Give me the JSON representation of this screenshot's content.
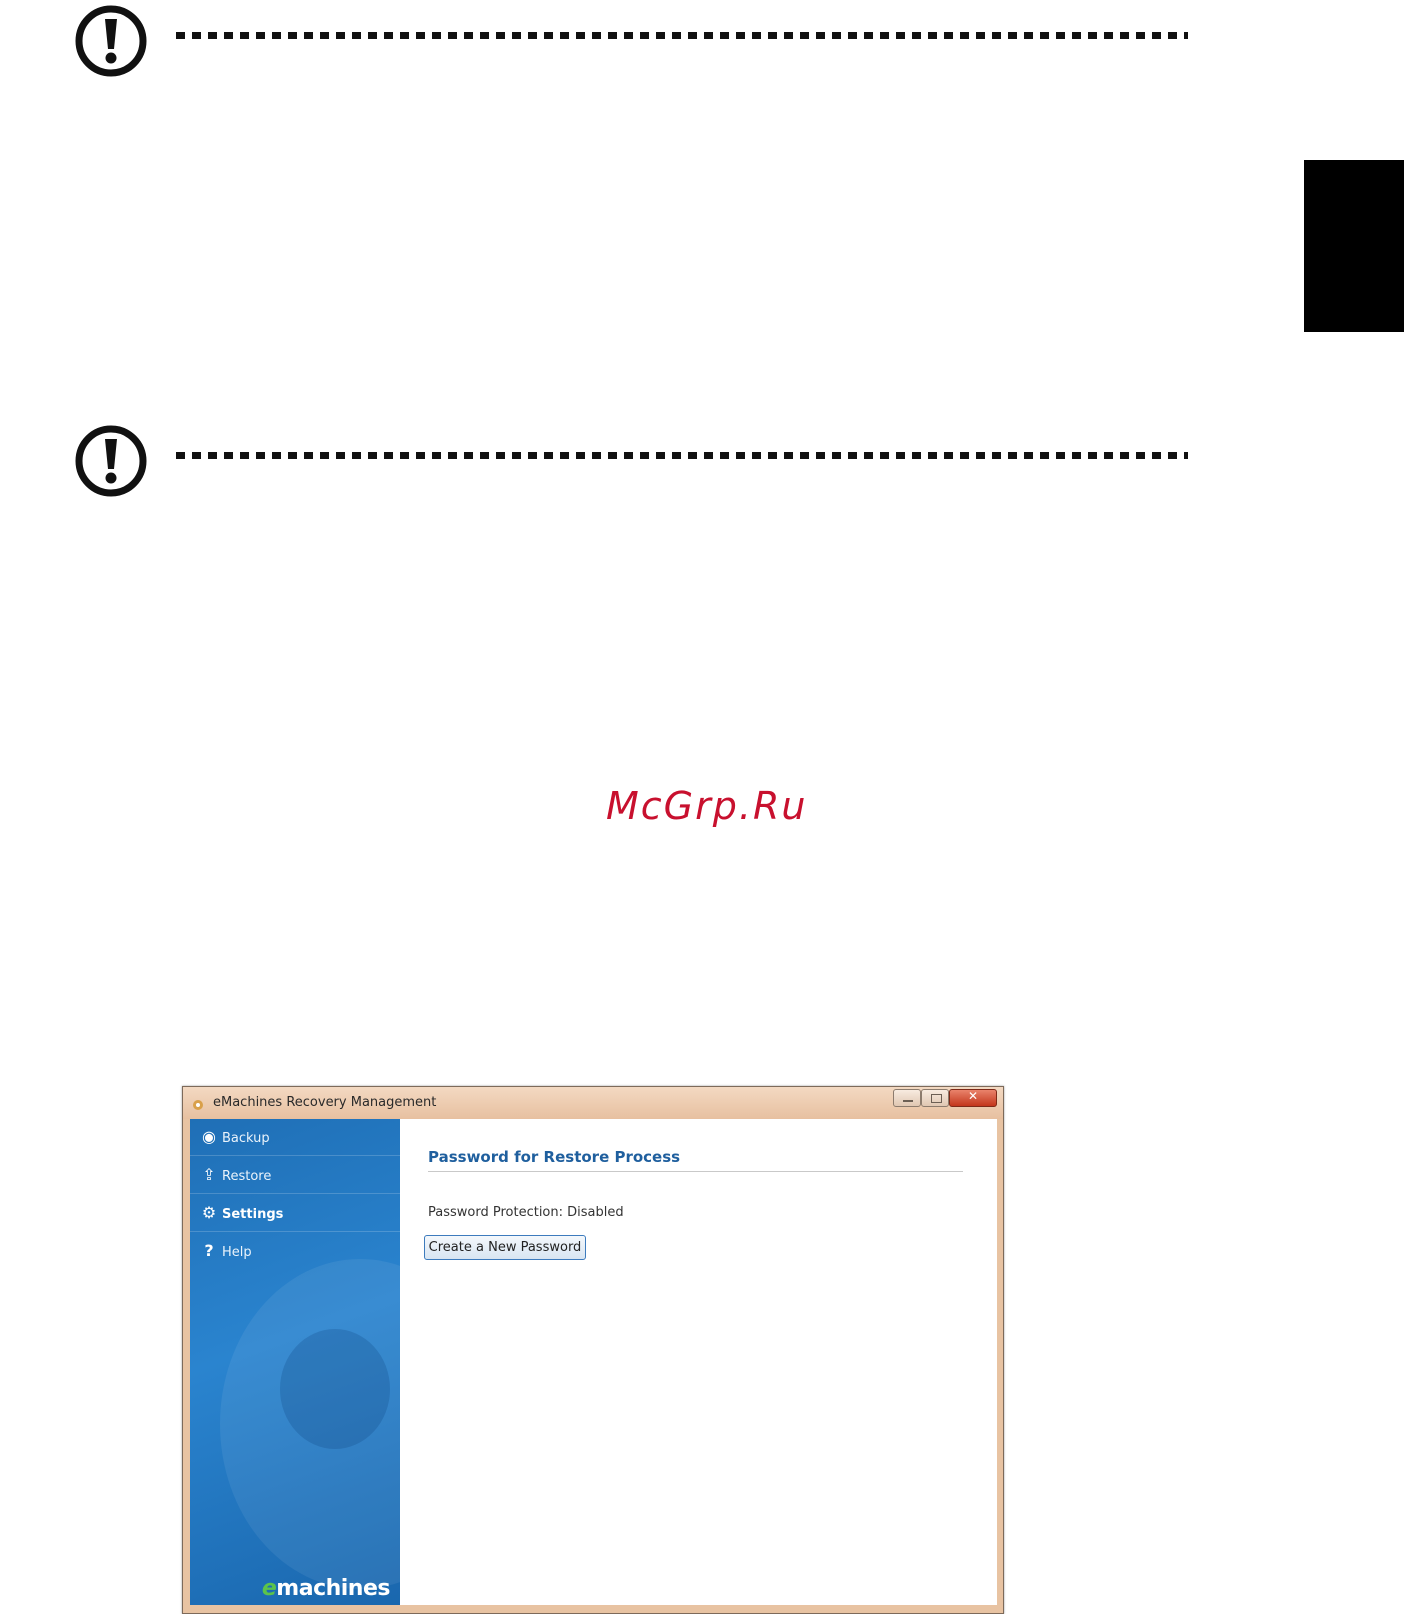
{
  "page": {
    "side_tab_color": "#000000",
    "watermark": "McGrp.Ru",
    "watermark_color": "#c8102e"
  },
  "icons": {
    "warning_1": "exclamation-circle-icon",
    "warning_2": "exclamation-circle-icon"
  },
  "window": {
    "title": "eMachines Recovery Management",
    "sidebar": {
      "items": [
        {
          "label": "Backup",
          "icon": "backup-icon"
        },
        {
          "label": "Restore",
          "icon": "restore-icon"
        },
        {
          "label": "Settings",
          "icon": "gear-icon",
          "active": true
        },
        {
          "label": "Help",
          "icon": "help-icon"
        }
      ],
      "brand_prefix": "e",
      "brand": "machines"
    },
    "content": {
      "heading": "Password for Restore Process",
      "status": "Password Protection: Disabled",
      "button_label": "Create a New Password"
    }
  }
}
